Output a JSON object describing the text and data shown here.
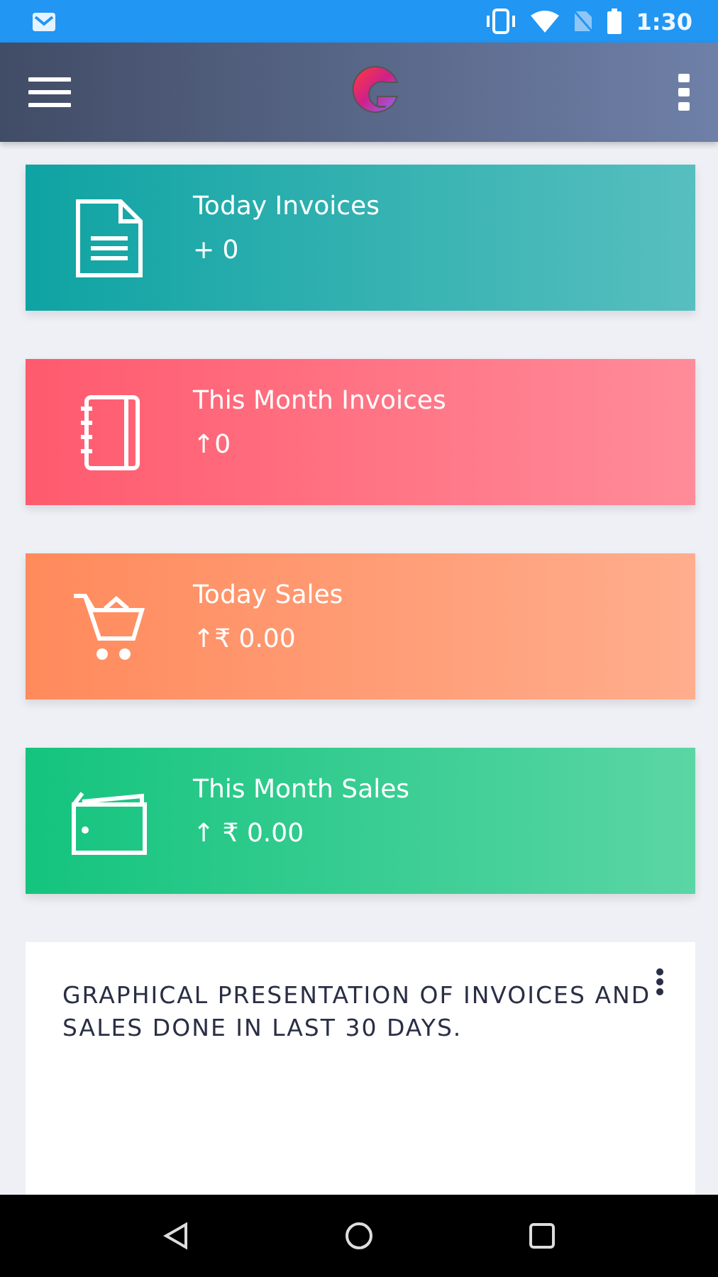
{
  "status_bar": {
    "time": "1:30"
  },
  "cards": [
    {
      "kind": "document",
      "title": "Today Invoices",
      "value": "+ 0",
      "color": "#0fa3a3"
    },
    {
      "kind": "notebook",
      "title": "This Month Invoices",
      "value": "↑0",
      "color": "#ff5a6e"
    },
    {
      "kind": "cart",
      "title": "Today Sales",
      "value": "↑₹ 0.00",
      "color": "#ff8a5c"
    },
    {
      "kind": "wallet",
      "title": "This Month Sales",
      "value": "↑ ₹ 0.00",
      "color": "#14c47e"
    }
  ],
  "chart_card": {
    "title": "GRAPHICAL PRESENTATION OF INVOICES AND SALES DONE IN LAST 30 DAYS."
  }
}
